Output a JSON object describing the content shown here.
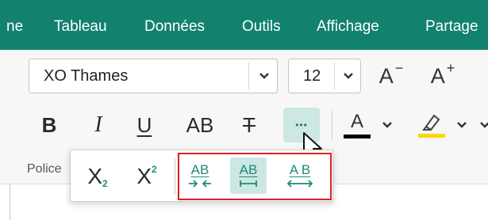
{
  "menu": {
    "items": [
      {
        "label": "ne",
        "name": "menu-item-home"
      },
      {
        "label": "Tableau",
        "name": "menu-item-tableau"
      },
      {
        "label": "Données",
        "name": "menu-item-donnees"
      },
      {
        "label": "Outils",
        "name": "menu-item-outils"
      },
      {
        "label": "Affichage",
        "name": "menu-item-affichage"
      },
      {
        "label": "Partage",
        "name": "menu-item-partage"
      }
    ]
  },
  "font": {
    "family_value": "XO Thames",
    "size_value": "12",
    "decrease_label": "A",
    "decrease_sup": "−",
    "increase_label": "A",
    "increase_sup": "+"
  },
  "format": {
    "bold": "B",
    "italic": "I",
    "underline": "U",
    "caps": "AB",
    "strikethrough": "T",
    "more": "•••"
  },
  "color": {
    "font_color_label": "A",
    "font_color": "#000000",
    "highlight_color": "#f5d90a"
  },
  "group": {
    "label": "Police"
  },
  "popup": {
    "subscript_label": "X",
    "subscript_sub": "2",
    "superscript_label": "X",
    "superscript_sup": "2",
    "condensed_label": "AB",
    "normal_spacing_label": "AB",
    "expanded_label": "A B"
  },
  "colors": {
    "accent": "#12826f",
    "selected_bg": "#cde7e2",
    "highlight_border": "#e02020",
    "popup_icon": "#1f8a78"
  }
}
